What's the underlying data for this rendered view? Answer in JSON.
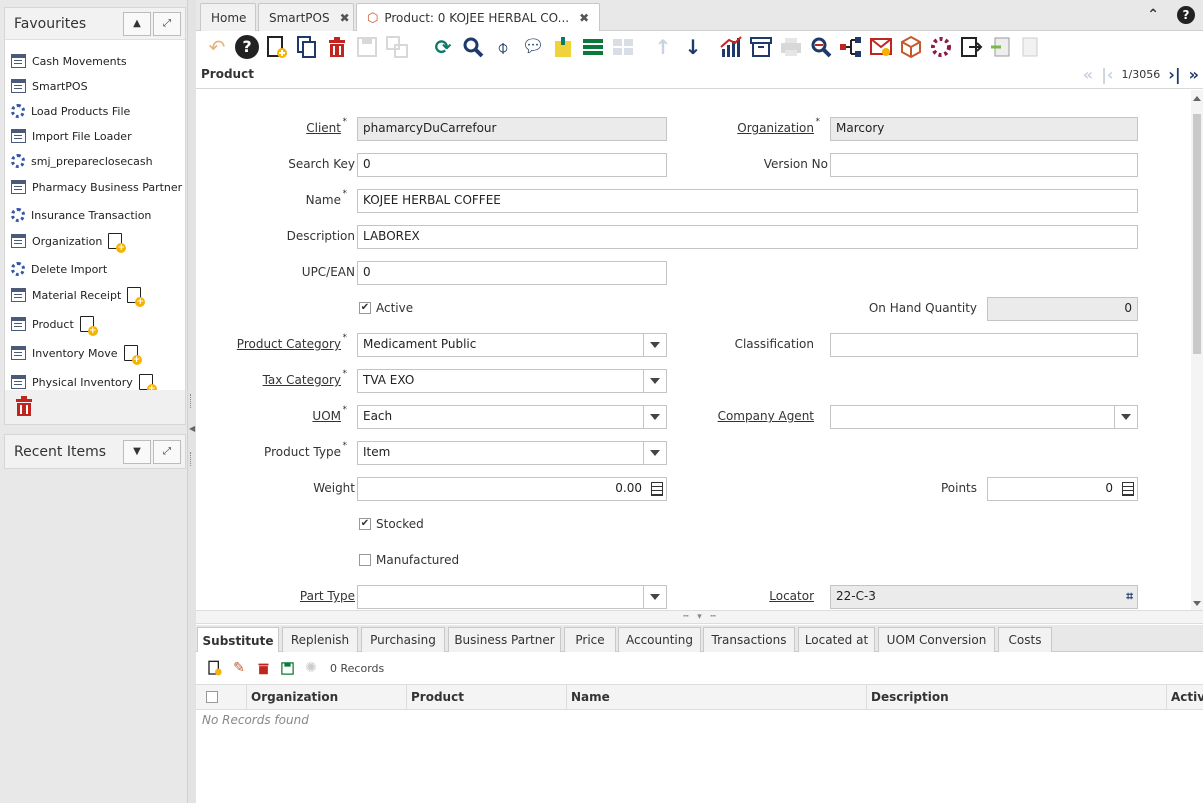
{
  "favourites": {
    "title": "Favourites",
    "items": [
      {
        "label": "Cash Movements",
        "icon": "window-icon",
        "new": false
      },
      {
        "label": "SmartPOS",
        "icon": "window-icon",
        "new": false
      },
      {
        "label": "Load Products File",
        "icon": "process-icon",
        "new": false
      },
      {
        "label": "Import File Loader",
        "icon": "window-icon",
        "new": false
      },
      {
        "label": "smj_prepareclosecash",
        "icon": "process-icon",
        "new": false
      },
      {
        "label": "Pharmacy Business Partner",
        "icon": "window-icon",
        "new": true
      },
      {
        "label": "Insurance Transaction",
        "icon": "process-icon",
        "new": false
      },
      {
        "label": "Organization",
        "icon": "window-icon",
        "new": true
      },
      {
        "label": "Delete Import",
        "icon": "process-icon",
        "new": false
      },
      {
        "label": "Material Receipt",
        "icon": "window-icon",
        "new": true
      },
      {
        "label": "Product",
        "icon": "window-icon",
        "new": true
      },
      {
        "label": "Inventory Move",
        "icon": "window-icon",
        "new": true
      },
      {
        "label": "Physical Inventory",
        "icon": "window-icon",
        "new": true
      }
    ]
  },
  "recent": {
    "title": "Recent Items"
  },
  "tabs": [
    {
      "label": "Home",
      "closable": false
    },
    {
      "label": "SmartPOS",
      "closable": true
    },
    {
      "label": "Product: 0 KOJEE HERBAL CO...",
      "closable": true,
      "active": true
    }
  ],
  "window": {
    "title": "Product",
    "record_nav": "1/3056"
  },
  "form": {
    "client": {
      "label": "Client",
      "value": "phamarcyDuCarrefour"
    },
    "organization": {
      "label": "Organization",
      "value": "Marcory"
    },
    "search_key": {
      "label": "Search Key",
      "value": "0"
    },
    "version_no": {
      "label": "Version No",
      "value": ""
    },
    "name": {
      "label": "Name",
      "value": "KOJEE HERBAL COFFEE"
    },
    "description": {
      "label": "Description",
      "value": "LABOREX"
    },
    "upc": {
      "label": "UPC/EAN",
      "value": "0"
    },
    "active": {
      "label": "Active",
      "checked": true
    },
    "on_hand": {
      "label": "On Hand Quantity",
      "value": "0"
    },
    "product_category": {
      "label": "Product Category",
      "value": "Medicament Public"
    },
    "classification": {
      "label": "Classification",
      "value": ""
    },
    "tax_category": {
      "label": "Tax Category",
      "value": "TVA EXO"
    },
    "uom": {
      "label": "UOM",
      "value": "Each"
    },
    "company_agent": {
      "label": "Company Agent",
      "value": ""
    },
    "product_type": {
      "label": "Product Type",
      "value": "Item"
    },
    "weight": {
      "label": "Weight",
      "value": "0.00"
    },
    "points": {
      "label": "Points",
      "value": "0"
    },
    "stocked": {
      "label": "Stocked",
      "checked": true
    },
    "manufactured": {
      "label": "Manufactured",
      "checked": false
    },
    "part_type": {
      "label": "Part Type",
      "value": ""
    },
    "locator": {
      "label": "Locator",
      "value": "22-C-3"
    }
  },
  "detail_tabs": [
    "Substitute",
    "Replenish",
    "Purchasing",
    "Business Partner",
    "Price",
    "Accounting",
    "Transactions",
    "Located at",
    "UOM Conversion",
    "Costs"
  ],
  "detail": {
    "records": "0 Records",
    "columns": [
      "Organization",
      "Product",
      "Name",
      "Description",
      "Active"
    ],
    "empty": "No Records found"
  },
  "colors": {
    "accent": "#1d3a6b",
    "teal": "#0c7a6b",
    "red": "#c0261f"
  }
}
